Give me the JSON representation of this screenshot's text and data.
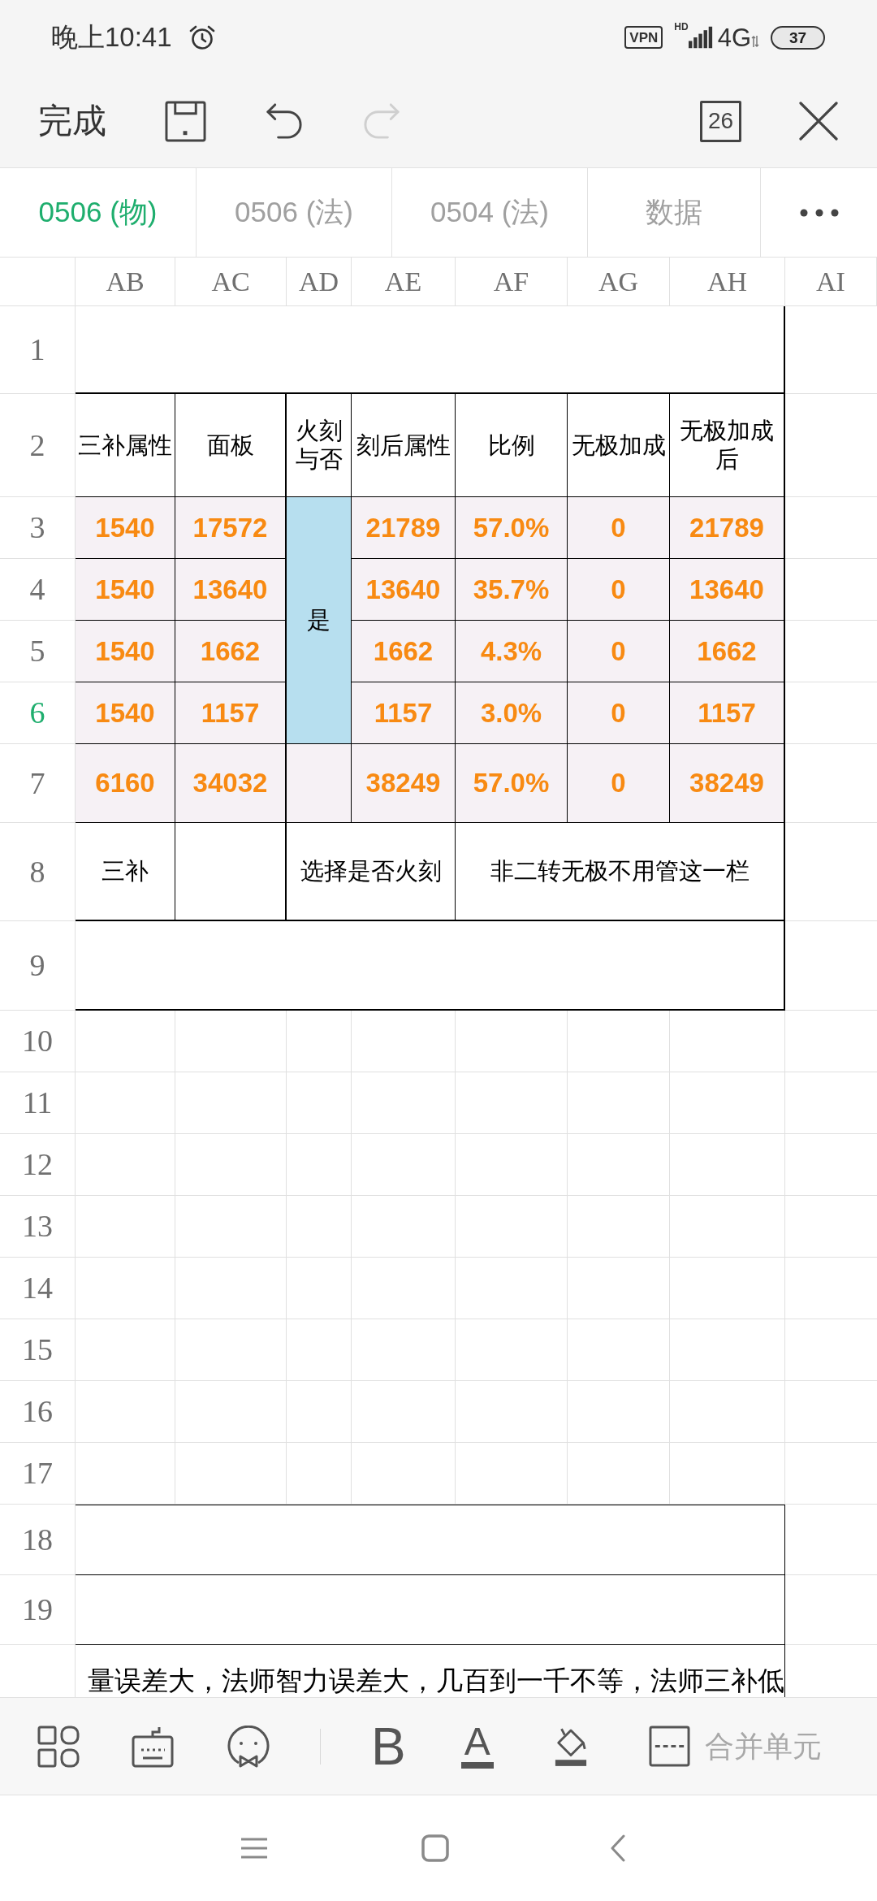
{
  "status_bar": {
    "time": "晚上10:41",
    "vpn": "VPN",
    "hd": "HD",
    "network": "4G",
    "battery": "37"
  },
  "toolbar": {
    "done": "完成",
    "actions": [
      {
        "kind": "save",
        "disabled": false
      },
      {
        "kind": "undo",
        "disabled": false
      },
      {
        "kind": "redo",
        "disabled": true
      }
    ],
    "sheet_count": "26"
  },
  "sheet_tabs": [
    {
      "label": "0506 (物)",
      "selected": true
    },
    {
      "label": "0506 (法)",
      "selected": false
    },
    {
      "label": "0504 (法)",
      "selected": false
    },
    {
      "label": "数据",
      "selected": false
    }
  ],
  "sheet": {
    "columns": [
      {
        "label": "AB",
        "selected": false
      },
      {
        "label": "AC",
        "selected": false
      },
      {
        "label": "AD",
        "selected": false
      },
      {
        "label": "AE",
        "selected": false
      },
      {
        "label": "AF",
        "selected": false
      },
      {
        "label": "AG",
        "selected": false
      },
      {
        "label": "AH",
        "selected": false
      },
      {
        "label": "AI",
        "selected": false
      }
    ],
    "rows": [
      {
        "label": "1",
        "selected": false
      },
      {
        "label": "2",
        "selected": false
      },
      {
        "label": "3",
        "selected": false
      },
      {
        "label": "4",
        "selected": false
      },
      {
        "label": "5",
        "selected": false
      },
      {
        "label": "6",
        "selected": true
      },
      {
        "label": "7",
        "selected": false
      },
      {
        "label": "8",
        "selected": false
      },
      {
        "label": "9",
        "selected": false
      },
      {
        "label": "10",
        "selected": false
      },
      {
        "label": "11",
        "selected": false
      },
      {
        "label": "12",
        "selected": false
      },
      {
        "label": "13",
        "selected": false
      },
      {
        "label": "14",
        "selected": false
      },
      {
        "label": "15",
        "selected": false
      },
      {
        "label": "16",
        "selected": false
      },
      {
        "label": "17",
        "selected": false
      },
      {
        "label": "18",
        "selected": false
      },
      {
        "label": "19",
        "selected": false
      }
    ],
    "header": [
      "三补属性",
      "面板",
      "火刻与否",
      "刻后属性",
      "比例",
      "无极加成",
      "无极加成后"
    ],
    "data_rows": [
      [
        "1540",
        "17572",
        "21789",
        "57.0%",
        "0",
        "21789"
      ],
      [
        "1540",
        "13640",
        "13640",
        "35.7%",
        "0",
        "13640"
      ],
      [
        "1540",
        "1662",
        "1662",
        "4.3%",
        "0",
        "1662"
      ],
      [
        "1540",
        "1157",
        "1157",
        "3.0%",
        "0",
        "1157"
      ]
    ],
    "fire_choice": "是",
    "total_row": [
      "6160",
      "34032",
      "38249",
      "57.0%",
      "0",
      "38249"
    ],
    "notes_row": [
      "三补",
      "选择是否火刻",
      "非二转无极不用管这一栏"
    ],
    "footnote": "量误差大，法师智力误差大，几百到一千不等，法师三补低"
  },
  "format_bar": {
    "bold": "B",
    "font_color": "A",
    "merge": "合并单元"
  }
}
